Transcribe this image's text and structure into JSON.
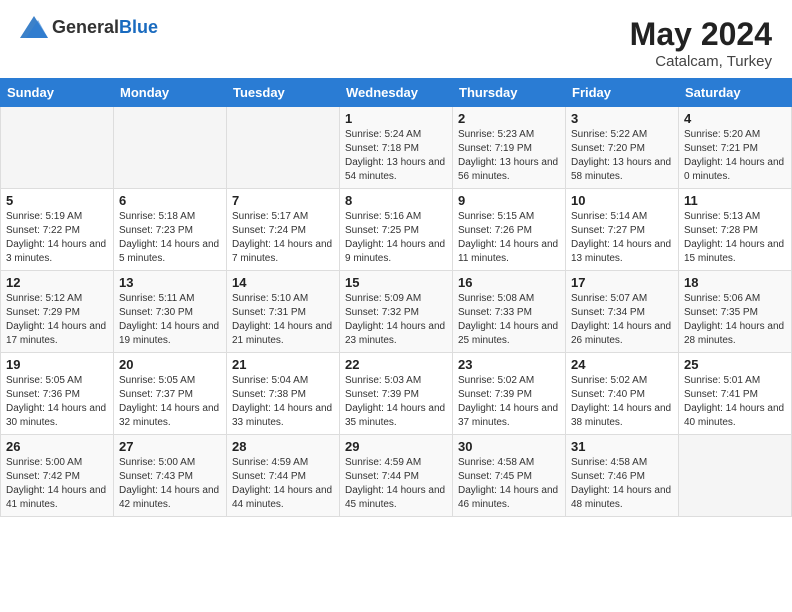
{
  "header": {
    "logo_general": "General",
    "logo_blue": "Blue",
    "month_year": "May 2024",
    "location": "Catalcam, Turkey"
  },
  "days_of_week": [
    "Sunday",
    "Monday",
    "Tuesday",
    "Wednesday",
    "Thursday",
    "Friday",
    "Saturday"
  ],
  "weeks": [
    [
      {
        "day": "",
        "sunrise": "",
        "sunset": "",
        "daylight": ""
      },
      {
        "day": "",
        "sunrise": "",
        "sunset": "",
        "daylight": ""
      },
      {
        "day": "",
        "sunrise": "",
        "sunset": "",
        "daylight": ""
      },
      {
        "day": "1",
        "sunrise": "Sunrise: 5:24 AM",
        "sunset": "Sunset: 7:18 PM",
        "daylight": "Daylight: 13 hours and 54 minutes."
      },
      {
        "day": "2",
        "sunrise": "Sunrise: 5:23 AM",
        "sunset": "Sunset: 7:19 PM",
        "daylight": "Daylight: 13 hours and 56 minutes."
      },
      {
        "day": "3",
        "sunrise": "Sunrise: 5:22 AM",
        "sunset": "Sunset: 7:20 PM",
        "daylight": "Daylight: 13 hours and 58 minutes."
      },
      {
        "day": "4",
        "sunrise": "Sunrise: 5:20 AM",
        "sunset": "Sunset: 7:21 PM",
        "daylight": "Daylight: 14 hours and 0 minutes."
      }
    ],
    [
      {
        "day": "5",
        "sunrise": "Sunrise: 5:19 AM",
        "sunset": "Sunset: 7:22 PM",
        "daylight": "Daylight: 14 hours and 3 minutes."
      },
      {
        "day": "6",
        "sunrise": "Sunrise: 5:18 AM",
        "sunset": "Sunset: 7:23 PM",
        "daylight": "Daylight: 14 hours and 5 minutes."
      },
      {
        "day": "7",
        "sunrise": "Sunrise: 5:17 AM",
        "sunset": "Sunset: 7:24 PM",
        "daylight": "Daylight: 14 hours and 7 minutes."
      },
      {
        "day": "8",
        "sunrise": "Sunrise: 5:16 AM",
        "sunset": "Sunset: 7:25 PM",
        "daylight": "Daylight: 14 hours and 9 minutes."
      },
      {
        "day": "9",
        "sunrise": "Sunrise: 5:15 AM",
        "sunset": "Sunset: 7:26 PM",
        "daylight": "Daylight: 14 hours and 11 minutes."
      },
      {
        "day": "10",
        "sunrise": "Sunrise: 5:14 AM",
        "sunset": "Sunset: 7:27 PM",
        "daylight": "Daylight: 14 hours and 13 minutes."
      },
      {
        "day": "11",
        "sunrise": "Sunrise: 5:13 AM",
        "sunset": "Sunset: 7:28 PM",
        "daylight": "Daylight: 14 hours and 15 minutes."
      }
    ],
    [
      {
        "day": "12",
        "sunrise": "Sunrise: 5:12 AM",
        "sunset": "Sunset: 7:29 PM",
        "daylight": "Daylight: 14 hours and 17 minutes."
      },
      {
        "day": "13",
        "sunrise": "Sunrise: 5:11 AM",
        "sunset": "Sunset: 7:30 PM",
        "daylight": "Daylight: 14 hours and 19 minutes."
      },
      {
        "day": "14",
        "sunrise": "Sunrise: 5:10 AM",
        "sunset": "Sunset: 7:31 PM",
        "daylight": "Daylight: 14 hours and 21 minutes."
      },
      {
        "day": "15",
        "sunrise": "Sunrise: 5:09 AM",
        "sunset": "Sunset: 7:32 PM",
        "daylight": "Daylight: 14 hours and 23 minutes."
      },
      {
        "day": "16",
        "sunrise": "Sunrise: 5:08 AM",
        "sunset": "Sunset: 7:33 PM",
        "daylight": "Daylight: 14 hours and 25 minutes."
      },
      {
        "day": "17",
        "sunrise": "Sunrise: 5:07 AM",
        "sunset": "Sunset: 7:34 PM",
        "daylight": "Daylight: 14 hours and 26 minutes."
      },
      {
        "day": "18",
        "sunrise": "Sunrise: 5:06 AM",
        "sunset": "Sunset: 7:35 PM",
        "daylight": "Daylight: 14 hours and 28 minutes."
      }
    ],
    [
      {
        "day": "19",
        "sunrise": "Sunrise: 5:05 AM",
        "sunset": "Sunset: 7:36 PM",
        "daylight": "Daylight: 14 hours and 30 minutes."
      },
      {
        "day": "20",
        "sunrise": "Sunrise: 5:05 AM",
        "sunset": "Sunset: 7:37 PM",
        "daylight": "Daylight: 14 hours and 32 minutes."
      },
      {
        "day": "21",
        "sunrise": "Sunrise: 5:04 AM",
        "sunset": "Sunset: 7:38 PM",
        "daylight": "Daylight: 14 hours and 33 minutes."
      },
      {
        "day": "22",
        "sunrise": "Sunrise: 5:03 AM",
        "sunset": "Sunset: 7:39 PM",
        "daylight": "Daylight: 14 hours and 35 minutes."
      },
      {
        "day": "23",
        "sunrise": "Sunrise: 5:02 AM",
        "sunset": "Sunset: 7:39 PM",
        "daylight": "Daylight: 14 hours and 37 minutes."
      },
      {
        "day": "24",
        "sunrise": "Sunrise: 5:02 AM",
        "sunset": "Sunset: 7:40 PM",
        "daylight": "Daylight: 14 hours and 38 minutes."
      },
      {
        "day": "25",
        "sunrise": "Sunrise: 5:01 AM",
        "sunset": "Sunset: 7:41 PM",
        "daylight": "Daylight: 14 hours and 40 minutes."
      }
    ],
    [
      {
        "day": "26",
        "sunrise": "Sunrise: 5:00 AM",
        "sunset": "Sunset: 7:42 PM",
        "daylight": "Daylight: 14 hours and 41 minutes."
      },
      {
        "day": "27",
        "sunrise": "Sunrise: 5:00 AM",
        "sunset": "Sunset: 7:43 PM",
        "daylight": "Daylight: 14 hours and 42 minutes."
      },
      {
        "day": "28",
        "sunrise": "Sunrise: 4:59 AM",
        "sunset": "Sunset: 7:44 PM",
        "daylight": "Daylight: 14 hours and 44 minutes."
      },
      {
        "day": "29",
        "sunrise": "Sunrise: 4:59 AM",
        "sunset": "Sunset: 7:44 PM",
        "daylight": "Daylight: 14 hours and 45 minutes."
      },
      {
        "day": "30",
        "sunrise": "Sunrise: 4:58 AM",
        "sunset": "Sunset: 7:45 PM",
        "daylight": "Daylight: 14 hours and 46 minutes."
      },
      {
        "day": "31",
        "sunrise": "Sunrise: 4:58 AM",
        "sunset": "Sunset: 7:46 PM",
        "daylight": "Daylight: 14 hours and 48 minutes."
      },
      {
        "day": "",
        "sunrise": "",
        "sunset": "",
        "daylight": ""
      }
    ]
  ]
}
